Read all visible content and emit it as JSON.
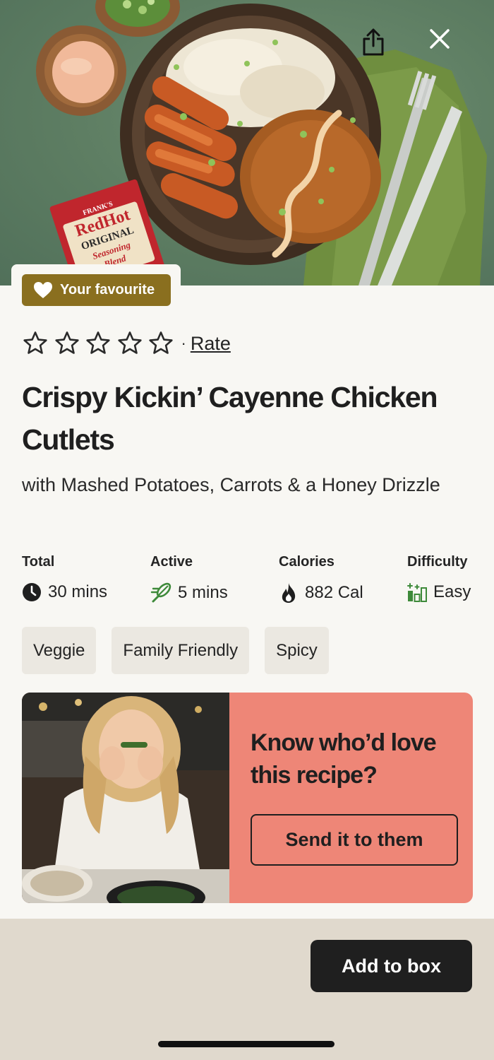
{
  "hero": {
    "share_icon": "share-icon",
    "close_icon": "close-icon",
    "packet_brand": "RedHot",
    "packet_top": "FRANK'S",
    "packet_line1": "ORIGINAL",
    "packet_line2": "Seasoning",
    "packet_line3": "Blend"
  },
  "favourite": {
    "label": "Your favourite",
    "icon": "heart-icon",
    "color": "#8a6f1f"
  },
  "rating": {
    "stars_filled": 0,
    "stars_total": 5,
    "separator": "·",
    "rate_label": "Rate"
  },
  "recipe": {
    "title": "Crispy Kickin’ Cayenne Chicken Cutlets",
    "subtitle": "with Mashed Potatoes, Carrots & a Honey Drizzle"
  },
  "stats": [
    {
      "label": "Total",
      "value": "30 mins",
      "icon": "clock-icon"
    },
    {
      "label": "Active",
      "value": "5 mins",
      "icon": "whisk-icon"
    },
    {
      "label": "Calories",
      "value": "882 Cal",
      "icon": "flame-icon"
    },
    {
      "label": "Difficulty",
      "value": "Easy",
      "icon": "difficulty-bars-icon"
    }
  ],
  "tags": [
    "Veggie",
    "Family Friendly",
    "Spicy"
  ],
  "promo": {
    "heading": "Know who’d love this recipe?",
    "button_label": "Send it to them",
    "background": "#ee8677"
  },
  "cta": {
    "add_label": "Add to box"
  }
}
